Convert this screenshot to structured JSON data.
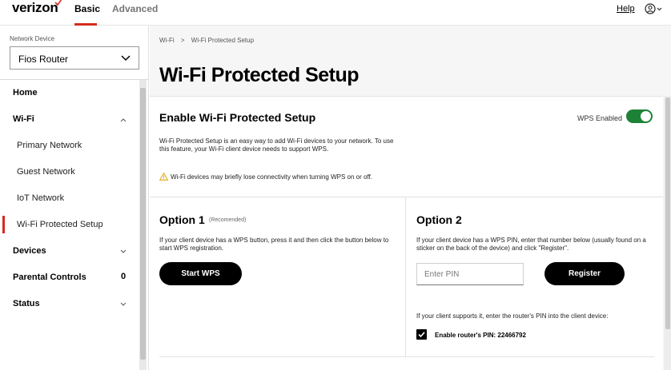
{
  "header": {
    "logo": "verizon",
    "tabs": [
      {
        "label": "Basic",
        "active": true
      },
      {
        "label": "Advanced",
        "active": false
      }
    ],
    "help": "Help",
    "user_icon": "user-circle-icon"
  },
  "sidebar": {
    "device_label": "Network Device",
    "device_value": "Fios Router",
    "items": [
      {
        "label": "Home",
        "level": "top"
      },
      {
        "label": "Wi-Fi",
        "level": "top",
        "expanded": true
      },
      {
        "label": "Primary Network",
        "level": "sub"
      },
      {
        "label": "Guest Network",
        "level": "sub"
      },
      {
        "label": "IoT Network",
        "level": "sub"
      },
      {
        "label": "Wi-Fi Protected Setup",
        "level": "sub",
        "active": true
      },
      {
        "label": "Devices",
        "level": "top"
      },
      {
        "label": "Parental Controls",
        "level": "top",
        "count": "0"
      },
      {
        "label": "Status",
        "level": "top"
      }
    ]
  },
  "breadcrumb": [
    "Wi-Fi",
    ">",
    "Wi-Fi Protected Setup"
  ],
  "page_title": "Wi-Fi Protected Setup",
  "enable_section": {
    "title": "Enable Wi-Fi Protected Setup",
    "status_label": "WPS Enabled",
    "enabled": true,
    "description": "Wi-Fi Protected Setup is an easy way to add Wi-Fi devices to your network. To use this feature, your Wi-Fi client device needs to support WPS.",
    "warning": "Wi-Fi devices may briefly lose connectivity when turning WPS on or off."
  },
  "option1": {
    "title": "Option 1",
    "recommended": "(Recomended)",
    "description": "If your client device has a WPS button, press it and then click the button below to start WPS registration.",
    "button": "Start WPS"
  },
  "option2": {
    "title": "Option 2",
    "description": "If your client device has a WPS PIN, enter that number below (usually found on a sticker on the back of the device) and click \"Register\".",
    "pin_placeholder": "Enter PIN",
    "button": "Register",
    "router_note": "If your client supports it, enter the router's PIN into the client device:",
    "router_pin_label": "Enable router's PIN: 22466792",
    "router_pin_checked": true
  },
  "colors": {
    "brand_red": "#d52b1e",
    "toggle_green": "#1d8235",
    "button_black": "#000000"
  }
}
